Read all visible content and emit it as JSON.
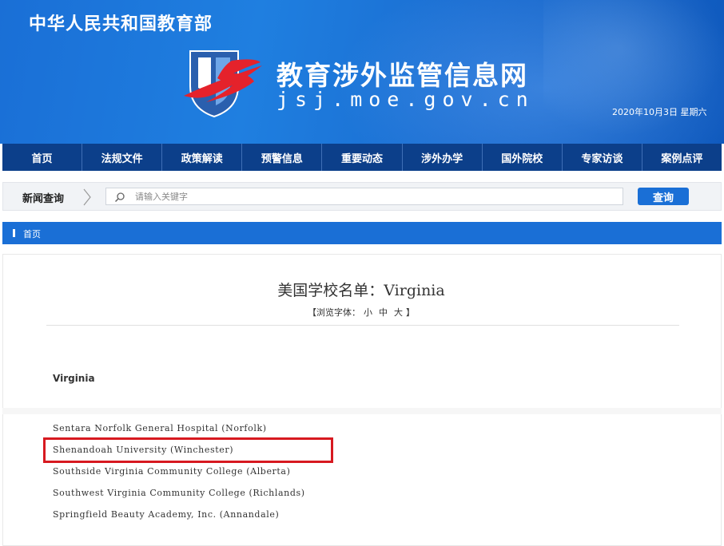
{
  "header": {
    "ministry": "中华人民共和国教育部",
    "site_title": "教育涉外监管信息网",
    "site_domain": "jsj.moe.gov.cn",
    "date": "2020年10月3日 星期六"
  },
  "nav": {
    "items": [
      "首页",
      "法规文件",
      "政策解读",
      "预警信息",
      "重要动态",
      "涉外办学",
      "国外院校",
      "专家访谈",
      "案例点评"
    ]
  },
  "search": {
    "label": "新闻查询",
    "placeholder": "请输入关键字",
    "button_label": "查询"
  },
  "breadcrumb": {
    "home": "首页"
  },
  "article": {
    "title": "美国学校名单：Virginia",
    "font_size_prefix": "【浏览字体：",
    "font_size_small": "小",
    "font_size_medium": "中",
    "font_size_large": "大",
    "font_size_suffix": "】",
    "state_heading": "Virginia",
    "schools": [
      "Sentara Norfolk General Hospital (Norfolk)",
      "Shenandoah University (Winchester)",
      "Southside Virginia Community College (Alberta)",
      "Southwest Virginia Community College (Richlands)",
      "Springfield Beauty Academy, Inc. (Annandale)"
    ],
    "highlighted_index": 1
  },
  "colors": {
    "banner_blue": "#1a6fd6",
    "nav_dark_blue": "#0c3f8a",
    "highlight_red": "#d71920",
    "logo_red": "#e5222b"
  }
}
